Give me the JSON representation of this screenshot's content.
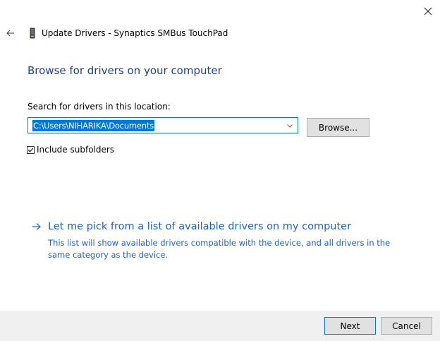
{
  "window": {
    "title": "Update Drivers - Synaptics SMBus TouchPad"
  },
  "page": {
    "heading": "Browse for drivers on your computer",
    "search_label": "Search for drivers in this location:",
    "path_value": "C:\\Users\\NIHARIKA\\Documents",
    "browse_label": "Browse...",
    "include_subfolders": {
      "label": "Include subfolders",
      "checked": true
    },
    "pick_link": {
      "label": "Let me pick from a list of available drivers on my computer",
      "description": "This list will show available drivers compatible with the device, and all drivers in the same category as the device."
    }
  },
  "footer": {
    "next_label": "Next",
    "cancel_label": "Cancel"
  },
  "icons": {
    "close": "close-icon",
    "back": "back-arrow-icon",
    "device": "touchpad-device-icon",
    "dropdown": "chevron-down-icon",
    "checkbox": "checkmark-icon",
    "link_arrow": "right-arrow-icon"
  },
  "colors": {
    "heading": "#1f3f8e",
    "link": "#1f62c1",
    "selection": "#0078d7",
    "button_face": "#e1e1e1",
    "footer_bg": "#f0f0f0"
  }
}
